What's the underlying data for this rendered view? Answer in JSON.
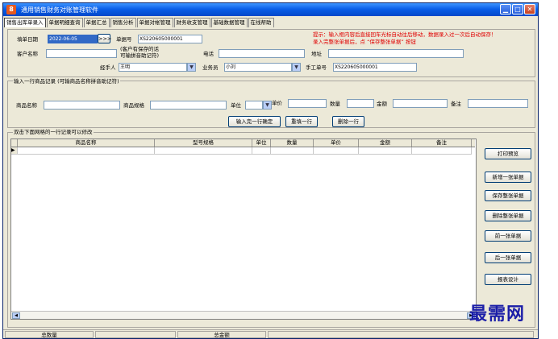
{
  "window": {
    "title": "通用销售财务对账管理软件",
    "app_icon_text": "8"
  },
  "tabs": [
    "销售出库单录入",
    "单据明细查询",
    "单据汇总",
    "销售分析",
    "单据对帐管理",
    "财务收支管理",
    "基础数据管理",
    "在线帮助"
  ],
  "header": {
    "date_label": "填单日期",
    "date_value": "2022-06-05",
    "date_btn": ">>>",
    "docno_label": "单据号",
    "docno_value": "XS220605000001",
    "tip_line1": "提示：输入框内容后直接回车光标自动往后移动，数据录入过一次后自动保存！",
    "tip_line2": "录入完整张单据后，点 “保存整张单据” 按钮",
    "customer_label": "客户名称",
    "customer_value": "",
    "customer_hint_1": "(客户有保存的话",
    "customer_hint_2": "可输拼音助记符)",
    "phone_label": "电话",
    "phone_value": "",
    "address_label": "地址",
    "address_value": "",
    "handler_label": "经手人",
    "handler_value": "王明",
    "sales_label": "业务员",
    "sales_value": "小刘",
    "manual_label": "手工单号",
    "manual_value": "XS220605000001"
  },
  "item_entry": {
    "group_title": "输入一行商品记录 (可输商品名称拼音助记符)",
    "name_label": "商品名称",
    "spec_label": "商品规格",
    "unit_label": "单位",
    "price_label": "单价",
    "qty_label": "数量",
    "amount_label": "金额",
    "note_label": "备注",
    "btn_complete": "输入完一行确定",
    "btn_refill": "重填一行",
    "btn_delete": "删除一行"
  },
  "grid": {
    "group_title": "双击下面网格的一行记录可以修改",
    "columns": [
      "商品名称",
      "型号规格",
      "单位",
      "数量",
      "单价",
      "金额",
      "备注"
    ],
    "rows": [],
    "row_marker": "▶"
  },
  "side_buttons": [
    "打印预览",
    "新增一张单据",
    "保存整张单据",
    "删除整张单据",
    "前一张单据",
    "后一张单据",
    "报表设计"
  ],
  "statusbar": {
    "total_qty_label": "总数量",
    "total_amount_label": "总金额"
  },
  "watermark": "最需网"
}
